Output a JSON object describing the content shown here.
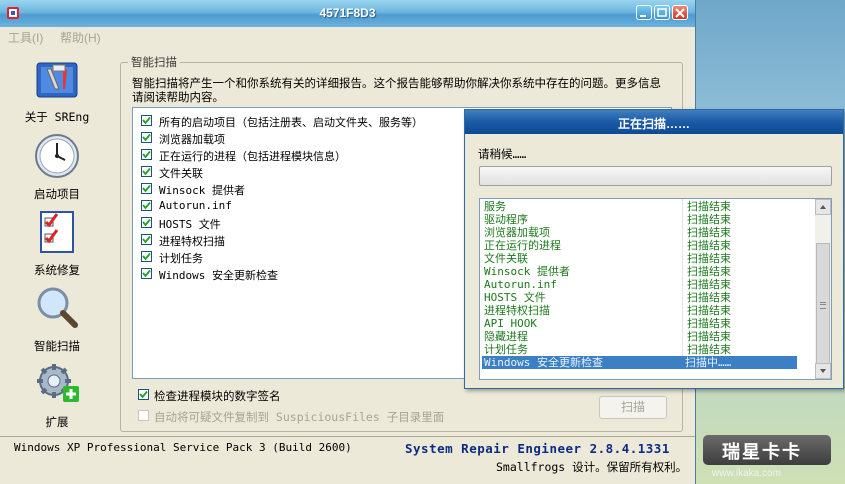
{
  "window": {
    "title": "4571F8D3"
  },
  "menu": [
    "工具(I)",
    "帮助(H)"
  ],
  "sidebar": [
    {
      "label": "关于 SREng",
      "icon": "toolbox-icon"
    },
    {
      "label": "启动项目",
      "icon": "clock-icon"
    },
    {
      "label": "系统修复",
      "icon": "checklist-icon"
    },
    {
      "label": "智能扫描",
      "icon": "magnifier-icon"
    },
    {
      "label": "扩展",
      "icon": "gear-plus-icon"
    }
  ],
  "scan_panel": {
    "group_title": "智能扫描",
    "description": "智能扫描将产生一个和你系统有关的详细报告。这个报告能够帮助你解决你系统中存在的问题。更多信息请阅读帮助内容。",
    "options": [
      {
        "label": "所有的启动项目（包括注册表、启动文件夹、服务等）",
        "checked": true
      },
      {
        "label": "浏览器加载项",
        "checked": true
      },
      {
        "label": "正在运行的进程（包括进程模块信息）",
        "checked": true
      },
      {
        "label": "文件关联",
        "checked": true
      },
      {
        "label": "Winsock 提供者",
        "checked": true
      },
      {
        "label": "Autorun.inf",
        "checked": true
      },
      {
        "label": "HOSTS 文件",
        "checked": true
      },
      {
        "label": "进程特权扫描",
        "checked": true
      },
      {
        "label": "计划任务",
        "checked": true
      },
      {
        "label": "Windows 安全更新检查",
        "checked": true
      }
    ],
    "verify_signature": {
      "label": "检查进程模块的数字签名",
      "checked": true
    },
    "auto_copy": {
      "label": "自动将可疑文件复制到 SuspiciousFiles 子目录里面",
      "checked": false,
      "disabled": true
    },
    "scan_button": "扫描"
  },
  "status": {
    "os": "Windows XP Professional Service Pack 3 (Build 2600)",
    "product": "System Repair Engineer 2.8.4.1331",
    "copyright": "Smallfrogs 设计。保留所有权利。"
  },
  "dialog": {
    "title": "正在扫描……",
    "wait_label": "请稍候……",
    "progress": 0.0,
    "results": [
      {
        "item": "服务",
        "status": "扫描结束"
      },
      {
        "item": "驱动程序",
        "status": "扫描结束"
      },
      {
        "item": "浏览器加载项",
        "status": "扫描结束"
      },
      {
        "item": "正在运行的进程",
        "status": "扫描结束"
      },
      {
        "item": "文件关联",
        "status": "扫描结束"
      },
      {
        "item": "Winsock 提供者",
        "status": "扫描结束"
      },
      {
        "item": "Autorun.inf",
        "status": "扫描结束"
      },
      {
        "item": "HOSTS 文件",
        "status": "扫描结束"
      },
      {
        "item": "进程特权扫描",
        "status": "扫描结束"
      },
      {
        "item": "API HOOK",
        "status": "扫描结束"
      },
      {
        "item": "隐藏进程",
        "status": "扫描结束"
      },
      {
        "item": "计划任务",
        "status": "扫描结束"
      },
      {
        "item": "Windows 安全更新检查",
        "status": "扫描中……",
        "selected": true
      }
    ]
  },
  "watermark": {
    "text": "瑞星卡卡",
    "url": "www.ikaka.com"
  },
  "colors": {
    "result_text": "#1d7a1d",
    "selected_row": "#3b7fc4",
    "product_text": "#0c2c84"
  }
}
